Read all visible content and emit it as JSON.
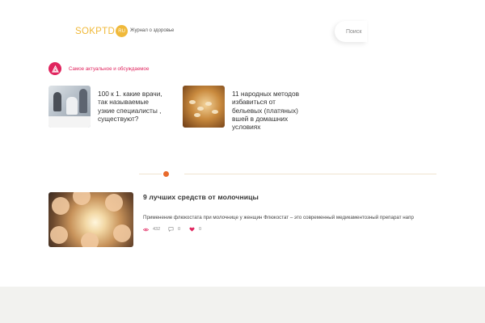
{
  "header": {
    "logo_text": "SOKPTD",
    "logo_badge": "RU",
    "tagline": "Журнал о здоровье",
    "search_placeholder": "Поиск"
  },
  "section": {
    "title": "Самое актуальное и обсуждаемое",
    "icon": "trending-icon",
    "accent_color": "#e0245e"
  },
  "featured": [
    {
      "title": "100 к 1. какие врачи, так называемые узкие специалисты , существуют?",
      "image": "doctors-meeting-photo"
    },
    {
      "title": "11 народных методов избавиться от бельевых (платяных) вшей в домашних условиях",
      "image": "lice-macro-photo"
    }
  ],
  "article": {
    "title": "9 лучших средств от молочницы",
    "excerpt": "Применение флюкостата при молочнице у женщин Флюкостат – это современный медикаментозный препарат напр",
    "views": "432",
    "comments": "0",
    "likes": "0",
    "image": "women-circle-photo"
  },
  "colors": {
    "logo": "#f0b93a",
    "divider_dot": "#e86a2c",
    "footer_bg": "#f2f2ef"
  }
}
